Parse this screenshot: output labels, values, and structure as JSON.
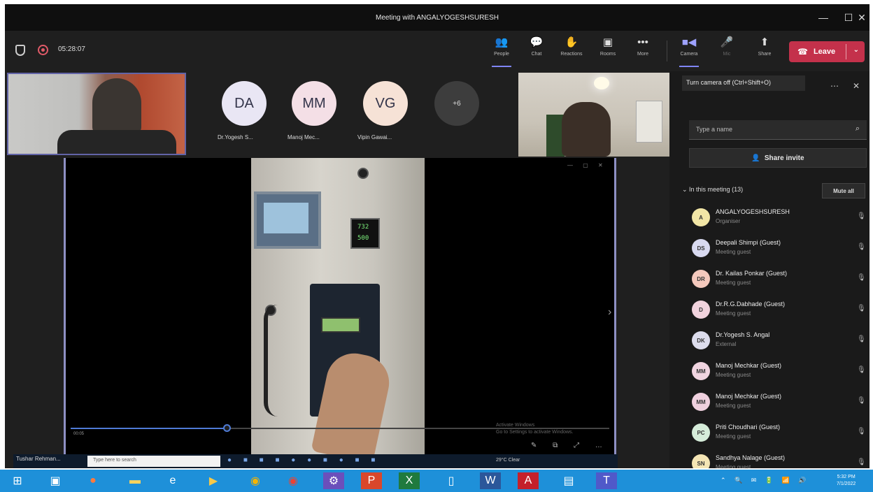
{
  "window": {
    "title": "Meeting with ANGALYOGESHSURESH",
    "minimize": "—",
    "maximize": "☐",
    "close": "✕"
  },
  "toolbar": {
    "timer": "05:28:07",
    "buttons": [
      {
        "label": "People",
        "icon": "people-icon",
        "glyph": "👥"
      },
      {
        "label": "Chat",
        "icon": "chat-icon",
        "glyph": "💬"
      },
      {
        "label": "Reactions",
        "icon": "reactions-icon",
        "glyph": "✋"
      },
      {
        "label": "Rooms",
        "icon": "rooms-icon",
        "glyph": "▣"
      },
      {
        "label": "More",
        "icon": "more-icon",
        "glyph": "•••"
      },
      {
        "label": "Camera",
        "icon": "camera-icon",
        "glyph": "■◀"
      },
      {
        "label": "Mic",
        "icon": "mic-icon",
        "glyph": "🎤"
      },
      {
        "label": "Share",
        "icon": "share-icon",
        "glyph": "⬆"
      }
    ],
    "leave_label": "Leave",
    "accent": "#7f85f5",
    "leave_color": "#c4314b"
  },
  "strip": {
    "participants": [
      {
        "initials": "DA",
        "name": "Dr.Yogesh S...",
        "color": "#e9e6f4"
      },
      {
        "initials": "MM",
        "name": "Manoj Mec...",
        "color": "#f4dfe6"
      },
      {
        "initials": "VG",
        "name": "Vipin Gawai...",
        "color": "#f6e2d6"
      }
    ],
    "more": "+6"
  },
  "shared": {
    "gauge_top": "732",
    "gauge_bottom": "500",
    "time": "00:05",
    "activate_line1": "Activate Windows",
    "activate_line2": "Go to Settings to activate Windows.",
    "taskbar_label": "Tushar Rehman...",
    "search_placeholder": "Type here to search",
    "weather": "29°C Clear"
  },
  "panel": {
    "tooltip": "Turn camera off (Ctrl+Shift+O)",
    "search_placeholder": "Type a name",
    "invite_label": "Share invite",
    "section_label": "In this meeting (13)",
    "mute_all": "Mute all",
    "participants": [
      {
        "initials": "A",
        "name": "ANGALYOGESHSURESH",
        "role": "Organiser",
        "color": "#f2e6a6"
      },
      {
        "initials": "DS",
        "name": "Deepali Shimpi (Guest)",
        "role": "Meeting guest",
        "color": "#d8d9f0"
      },
      {
        "initials": "DR",
        "name": "Dr. Kailas Ponkar (Guest)",
        "role": "Meeting guest",
        "color": "#f4c9bd"
      },
      {
        "initials": "D",
        "name": "Dr.R.G.Dabhade (Guest)",
        "role": "Meeting guest",
        "color": "#f1d3dd"
      },
      {
        "initials": "DK",
        "name": "Dr.Yogesh S. Angal",
        "role": "External",
        "color": "#dcdcec"
      },
      {
        "initials": "MM",
        "name": "Manoj Mechkar (Guest)",
        "role": "Meeting guest",
        "color": "#f0d4e0"
      },
      {
        "initials": "MM",
        "name": "Manoj Mechkar (Guest)",
        "role": "Meeting guest",
        "color": "#efd0de"
      },
      {
        "initials": "PC",
        "name": "Priti Choudhari (Guest)",
        "role": "Meeting guest",
        "color": "#d5ecd9"
      },
      {
        "initials": "SN",
        "name": "Sandhya Nalage (Guest)",
        "role": "Meeting guest",
        "color": "#f4e5b4"
      }
    ]
  },
  "taskbar": {
    "tray": "⌃ 🔍 ✉ 🔋 📶 🔊",
    "time": "5:32 PM",
    "date": "7/1/2022"
  }
}
